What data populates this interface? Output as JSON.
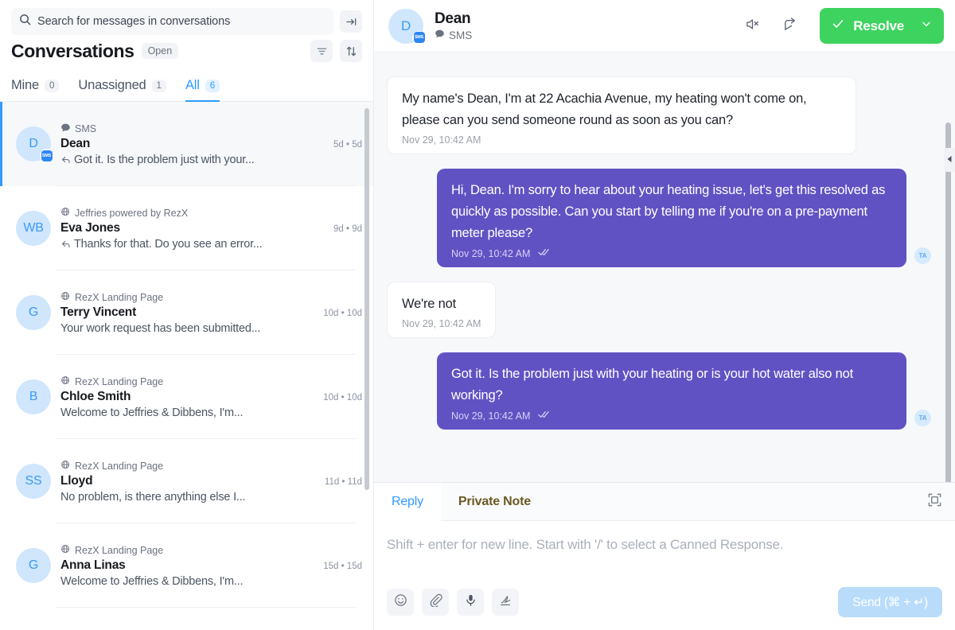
{
  "search": {
    "placeholder": "Search for messages in conversations",
    "icon": "search-icon",
    "collapse_icon": "collapse-panel-icon"
  },
  "list_header": {
    "title": "Conversations",
    "status_pill": "Open",
    "filter_icon": "filter-icon",
    "sort_icon": "sort-icon"
  },
  "tabs": [
    {
      "label": "Mine",
      "count": "0",
      "active": false
    },
    {
      "label": "Unassigned",
      "count": "1",
      "active": false
    },
    {
      "label": "All",
      "count": "6",
      "active": true
    }
  ],
  "conversations": [
    {
      "channel": "SMS",
      "channel_icon": "chat-bubble-icon",
      "name": "Dean",
      "time": "5d • 5d",
      "preview": "Got it. Is the problem just with your...",
      "has_reply_arrow": true,
      "avatar_initials": "D",
      "has_sms_badge": true,
      "badge_text": "SMS",
      "selected": true
    },
    {
      "channel": "Jeffries powered by RezX",
      "channel_icon": "globe-icon",
      "name": "Eva Jones",
      "time": "9d • 9d",
      "preview": "Thanks for that. Do you see an error...",
      "has_reply_arrow": true,
      "avatar_initials": "WB",
      "has_sms_badge": false,
      "selected": false
    },
    {
      "channel": "RezX Landing Page",
      "channel_icon": "globe-icon",
      "name": "Terry Vincent",
      "time": "10d • 10d",
      "preview": "Your work request has been submitted...",
      "has_reply_arrow": false,
      "avatar_initials": "G",
      "has_sms_badge": false,
      "selected": false
    },
    {
      "channel": "RezX Landing Page",
      "channel_icon": "globe-icon",
      "name": "Chloe Smith",
      "time": "10d • 10d",
      "preview": "Welcome to Jeffries & Dibbens, I'm...",
      "has_reply_arrow": false,
      "avatar_initials": "B",
      "has_sms_badge": false,
      "selected": false
    },
    {
      "channel": "RezX Landing Page",
      "channel_icon": "globe-icon",
      "name": "Lloyd",
      "time": "11d • 11d",
      "preview": "No problem, is there anything else I...",
      "has_reply_arrow": false,
      "avatar_initials": "SS",
      "has_sms_badge": false,
      "selected": false
    },
    {
      "channel": "RezX Landing Page",
      "channel_icon": "globe-icon",
      "name": "Anna Linas",
      "time": "15d • 15d",
      "preview": "Welcome to Jeffries & Dibbens, I'm...",
      "has_reply_arrow": false,
      "avatar_initials": "G",
      "has_sms_badge": false,
      "selected": false
    }
  ],
  "chat_header": {
    "avatar_initials": "D",
    "badge_text": "SMS",
    "name": "Dean",
    "channel": "SMS",
    "mute_icon": "mute-icon",
    "forward_icon": "forward-icon",
    "resolve_label": "Resolve",
    "resolve_check_icon": "check-icon",
    "resolve_caret_icon": "chevron-down-icon",
    "resolve_color": "#3ed35f"
  },
  "messages": [
    {
      "direction": "in",
      "text": "My name's Dean, I'm at 22 Acachia Avenue, my heating won't come on, please can you send someone round as soon as you can?",
      "timestamp": "Nov 29, 10:42 AM",
      "read_receipt": false,
      "agent_initials": ""
    },
    {
      "direction": "out",
      "text": "Hi, Dean. I'm sorry to hear about your heating issue, let's get this resolved as quickly as possible. Can you start by telling me if you're on a pre-payment meter please?",
      "timestamp": "Nov 29, 10:42 AM",
      "read_receipt": true,
      "agent_initials": "TA"
    },
    {
      "direction": "in",
      "text": "We're not",
      "timestamp": "Nov 29, 10:42 AM",
      "read_receipt": false,
      "agent_initials": ""
    },
    {
      "direction": "out",
      "text": "Got it. Is the problem just with your heating or is your hot water also not working?",
      "timestamp": "Nov 29, 10:42 AM",
      "read_receipt": true,
      "agent_initials": "TA"
    }
  ],
  "composer": {
    "tabs": [
      {
        "label": "Reply",
        "active": true
      },
      {
        "label": "Private Note",
        "active": false
      }
    ],
    "expand_icon": "expand-icon",
    "placeholder": "Shift + enter for new line. Start with '/' to select a Canned Response.",
    "tools": [
      {
        "icon": "emoji-icon"
      },
      {
        "icon": "attachment-icon"
      },
      {
        "icon": "microphone-icon"
      },
      {
        "icon": "signature-icon"
      }
    ],
    "send_label": "Send (⌘ + ↵)"
  },
  "panel": {
    "collapse_icon": "chevron-left-icon"
  }
}
